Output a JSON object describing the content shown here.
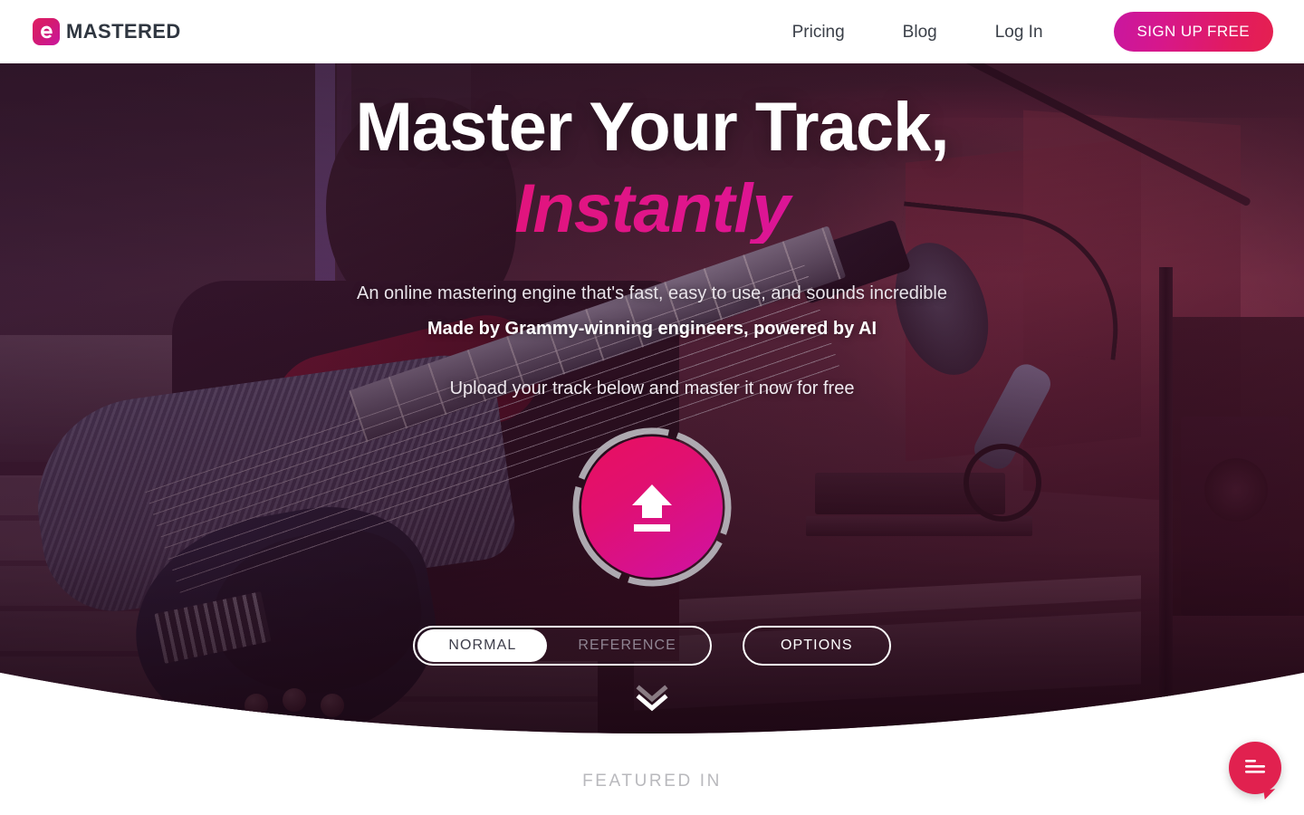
{
  "header": {
    "brand_name": "MASTERED",
    "logo_icon": "emastered-e-logo-icon",
    "nav": [
      {
        "label": "Pricing"
      },
      {
        "label": "Blog"
      },
      {
        "label": "Log In"
      }
    ],
    "signup_label": "SIGN UP FREE",
    "signup_gradient_from": "#c9179f",
    "signup_gradient_to": "#e52050"
  },
  "hero": {
    "headline_line1": "Master Your Track,",
    "headline_line2": "Instantly",
    "headline_accent_from": "#e4134f",
    "headline_accent_to": "#b915c4",
    "subtitle_1": "An online mastering engine that's fast, easy to use, and sounds incredible",
    "subtitle_2": "Made by Grammy-winning engineers, powered by AI",
    "subtitle_3": "Upload your track below and master it now for free",
    "upload": {
      "icon": "upload-arrow-icon",
      "gradient_from": "#e8105f",
      "gradient_to": "#cf12a4",
      "ring_color": "#b9b6bd"
    },
    "mode_toggle": {
      "options": [
        {
          "label": "NORMAL",
          "active": true
        },
        {
          "label": "REFERENCE",
          "active": false
        }
      ]
    },
    "options_label": "OPTIONS",
    "scroll_cue_icon": "double-chevron-down-icon"
  },
  "below_fold": {
    "featured_in_label": "FEATURED IN"
  },
  "chat_widget": {
    "icon": "chat-bubble-lines-icon",
    "color": "#e1214f"
  }
}
